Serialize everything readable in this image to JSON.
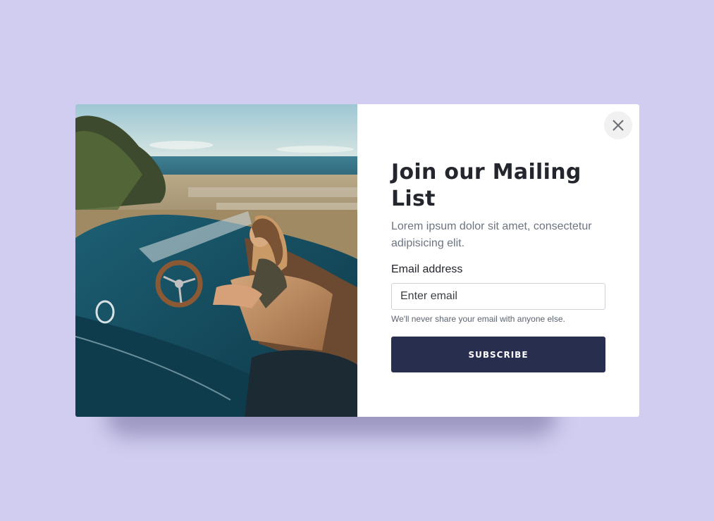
{
  "colors": {
    "page_background": "#d0cdf0",
    "card_background": "#ffffff",
    "button_background": "#282f4e",
    "title_color": "#24262d",
    "muted_text": "#6c7480"
  },
  "modal": {
    "image": {
      "description_icon": "photo-woman-in-vintage-convertible"
    },
    "close_icon": "close-icon",
    "title": "Join our Mailing List",
    "subtitle": "Lorem ipsum dolor sit amet, consectetur adipisicing elit.",
    "form": {
      "email_label": "Email address",
      "email_placeholder": "Enter email",
      "email_value": "",
      "help_text": "We'll never share your email with anyone else.",
      "submit_label": "SUBSCRIBE"
    }
  }
}
